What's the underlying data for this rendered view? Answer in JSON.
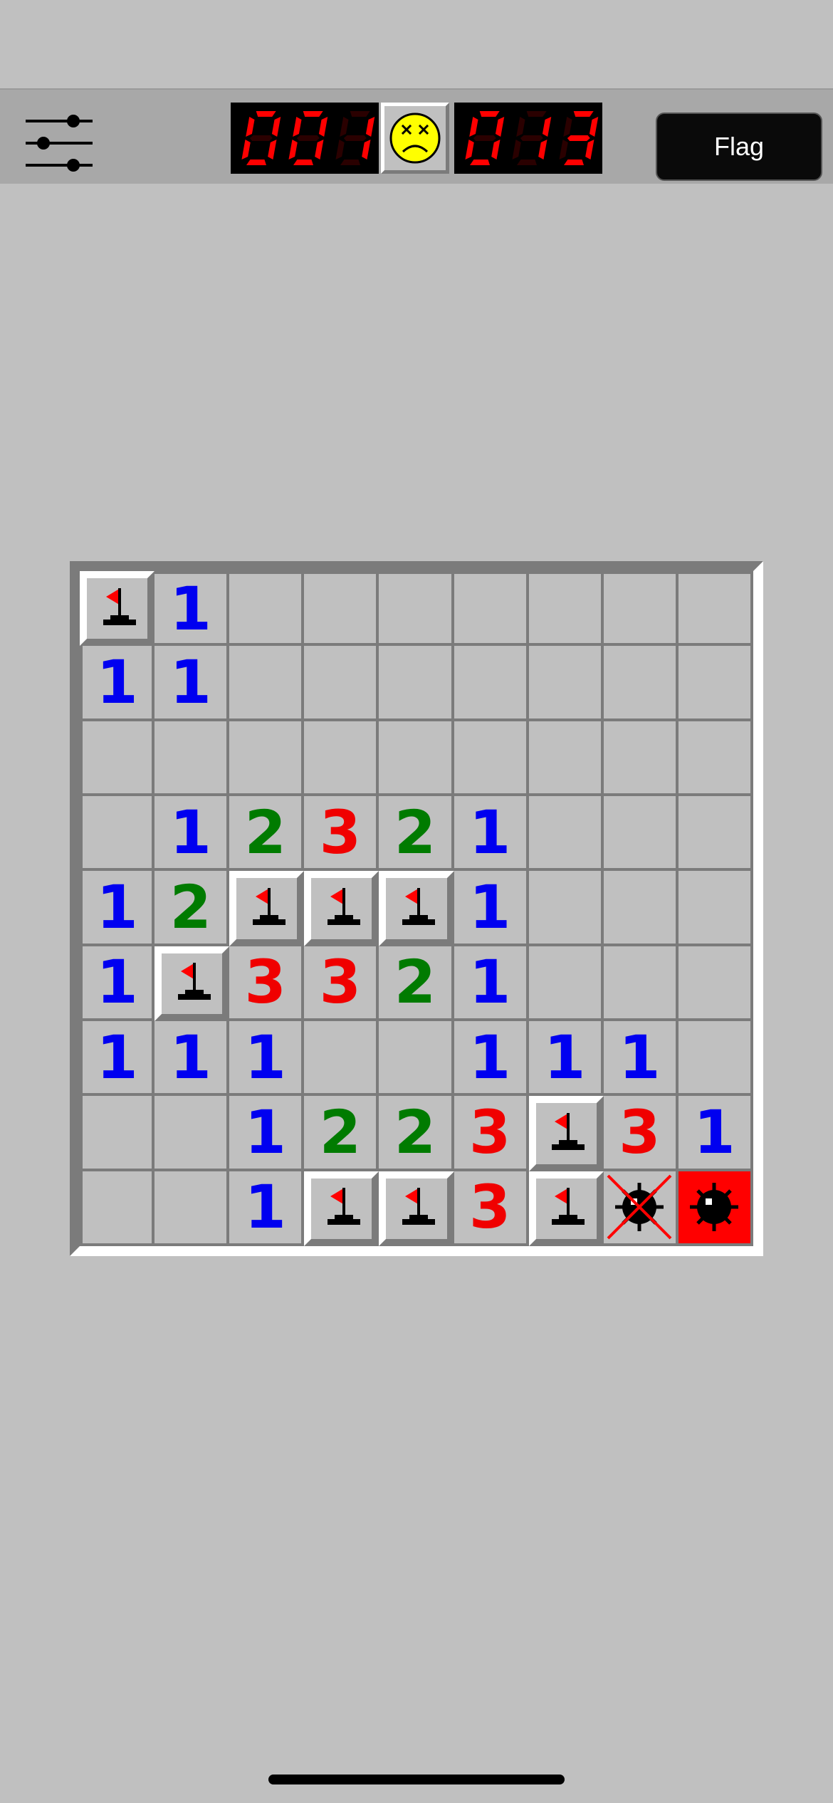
{
  "toolbar": {
    "settings_icon": "sliders-icon",
    "mines_remaining": "001",
    "face_state": "dead",
    "face_icon": "dead-face-icon",
    "timer": "013",
    "flag_label": "Flag"
  },
  "colors": {
    "background": "#c0c0c0",
    "toolbar": "#a8a8a8",
    "led": "#ff0000",
    "one": "#0000f0",
    "two": "#007b00",
    "three": "#f00000",
    "exploded": "#ff0000"
  },
  "board": {
    "rows": 9,
    "cols": 9,
    "cells": [
      [
        "F",
        "1",
        "",
        "",
        "",
        "",
        "",
        "",
        ""
      ],
      [
        "1",
        "1",
        "",
        "",
        "",
        "",
        "",
        "",
        ""
      ],
      [
        "",
        "",
        "",
        "",
        "",
        "",
        "",
        "",
        ""
      ],
      [
        "",
        "1",
        "2",
        "3",
        "2",
        "1",
        "",
        "",
        ""
      ],
      [
        "1",
        "2",
        "F",
        "F",
        "F",
        "1",
        "",
        "",
        ""
      ],
      [
        "1",
        "F",
        "3",
        "3",
        "2",
        "1",
        "",
        "",
        ""
      ],
      [
        "1",
        "1",
        "1",
        "",
        "",
        "1",
        "1",
        "1",
        ""
      ],
      [
        "",
        "",
        "1",
        "2",
        "2",
        "3",
        "F",
        "3",
        "1"
      ],
      [
        "",
        "",
        "1",
        "F",
        "F",
        "3",
        "F",
        "X",
        "B"
      ]
    ],
    "legend": {
      "F": "flag",
      "X": "wrong-flag-mine",
      "B": "exploded-mine"
    }
  }
}
